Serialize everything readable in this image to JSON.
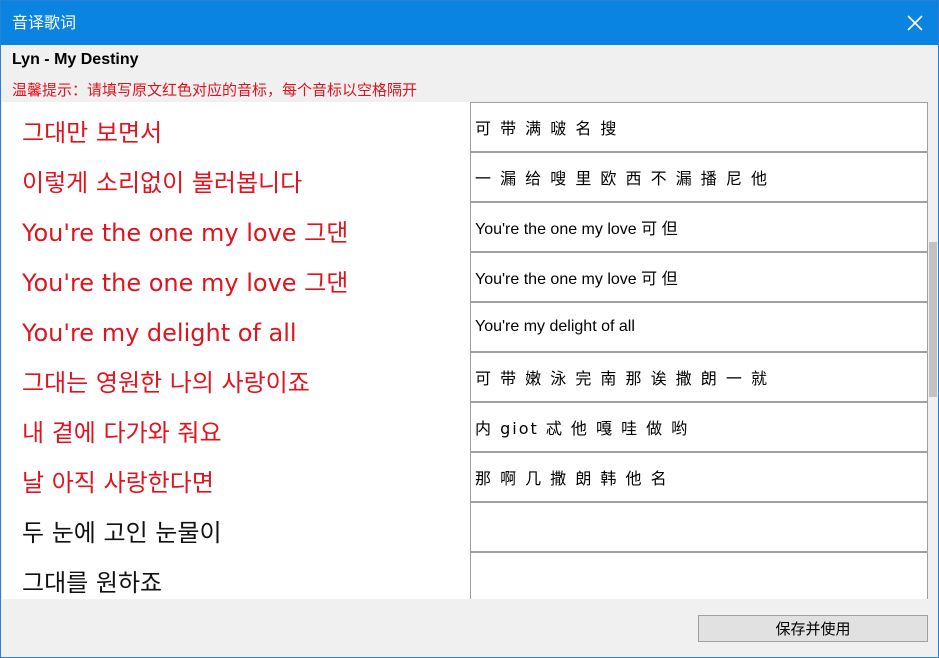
{
  "window": {
    "title": "音译歌词"
  },
  "header": {
    "song_title": "Lyn - My Destiny",
    "tip": "温馨提示：请填写原文红色对应的音标，每个音标以空格隔开"
  },
  "lyrics": [
    {
      "text": "그대만 보면서",
      "color": "red"
    },
    {
      "text": "이렇게 소리없이 불러봅니다",
      "color": "red"
    },
    {
      "text": "You're the one my love 그댄",
      "color": "red"
    },
    {
      "text": "You're the one my love 그댄",
      "color": "red"
    },
    {
      "text": "You're my delight of all",
      "color": "red"
    },
    {
      "text": "그대는 영원한 나의 사랑이죠",
      "color": "red"
    },
    {
      "text": "내 곁에 다가와 줘요",
      "color": "red"
    },
    {
      "text": "날 아직 사랑한다면",
      "color": "red"
    },
    {
      "text": "두 눈에 고인 눈물이",
      "color": "black"
    },
    {
      "text": "그대를 원하죠",
      "color": "black"
    }
  ],
  "inputs": [
    {
      "value": "可 带 满 啵 名 搜"
    },
    {
      "value": "一 漏 给 嗖 里 欧 西 不 漏 播 尼 他"
    },
    {
      "value": "You're the one my love 可 但"
    },
    {
      "value": "You're the one my love 可 但"
    },
    {
      "value": "You're my delight of all"
    },
    {
      "value": "可 带 嫩 泳 完 南 那 诶 撒 朗 一 就"
    },
    {
      "value": "内 giot 忒 他 嘎 哇 做 哟"
    },
    {
      "value": "那 啊 几 撒 朗 韩 他 名"
    },
    {
      "value": ""
    },
    {
      "value": ""
    }
  ],
  "footer": {
    "save_label": "保存并使用"
  },
  "colors": {
    "accent": "#0a84e0",
    "highlight_red": "#e0141e"
  }
}
